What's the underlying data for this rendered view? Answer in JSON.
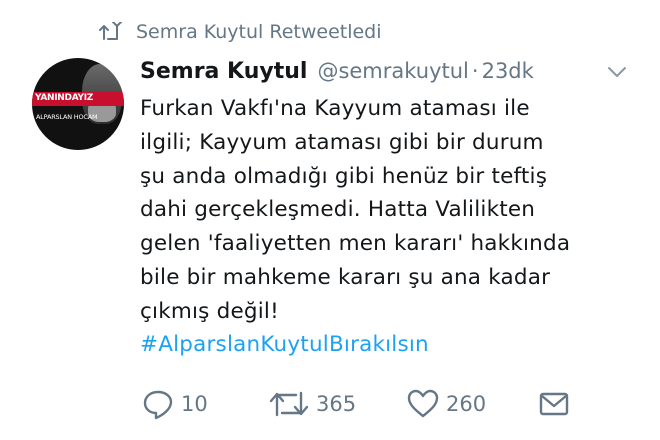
{
  "retweet_header": {
    "icon": "retweet-icon",
    "text": "Semra Kuytul Retweetledi"
  },
  "avatar": {
    "band_text": "YANINDAYIZ",
    "sub_text": "ALPARSLAN HOCAM"
  },
  "tweet": {
    "author_name": "Semra Kuytul",
    "handle": "@semrakuytul",
    "separator": "·",
    "time": "23dk",
    "lines": [
      "Furkan Vakfı'na Kayyum ataması ile",
      "ilgili; Kayyum ataması gibi bir durum",
      "şu anda olmadığı gibi henüz bir teftiş",
      "dahi gerçekleşmedi. Hatta Valilikten",
      "gelen 'faaliyetten men kararı' hakkında",
      "bile bir mahkeme kararı şu ana kadar",
      "çıkmış değil!"
    ],
    "hashtag": "#AlparslanKuytulBırakılsın"
  },
  "actions": {
    "reply_count": "10",
    "retweet_count": "365",
    "like_count": "260"
  },
  "colors": {
    "text": "#14171a",
    "muted": "#657786",
    "link": "#1da1f2"
  }
}
